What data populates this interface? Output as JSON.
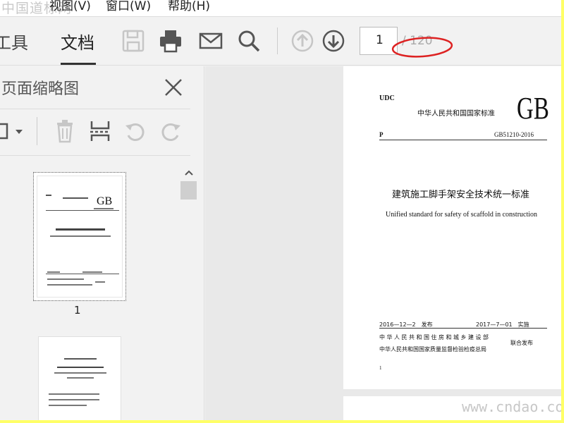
{
  "menu": {
    "items": [
      {
        "label": "视图(V)"
      },
      {
        "label": "窗口(W)"
      },
      {
        "label": "帮助(H)"
      }
    ],
    "watermark": "中国道标网"
  },
  "toolbar": {
    "tabs": [
      {
        "label": "工具"
      },
      {
        "label": "文档"
      }
    ],
    "page_number": "1",
    "page_total": "/ 120",
    "icons": [
      "save-icon",
      "print-icon",
      "mail-icon",
      "search-icon",
      "page-up-icon",
      "page-down-icon"
    ]
  },
  "panel": {
    "title": "页面缩略图",
    "tools": [
      "menu-icon",
      "delete-icon",
      "extract-icon",
      "rotate-left-icon",
      "rotate-right-icon"
    ],
    "thumbnails": [
      {
        "number": "1"
      }
    ]
  },
  "document": {
    "udc": "UDC",
    "issuer_line": "中华人民共和国国家标准",
    "gb": "GB",
    "p": "P",
    "code": "GB51210-2016",
    "title_cn": "建筑施工脚手架安全技术统一标准",
    "title_en": "Unified standard for safety of scaffold in construction",
    "issue_date": "2016—12—2　发布",
    "impl_date": "2017—7—01　实施",
    "publisher1": "中华人民共和国住房和城乡建设部",
    "publisher2": "中华人民共和国国家质量监督检验检疫总局",
    "joint": "联合发布",
    "page_footer": "1"
  },
  "watermark_bottom": "www.cndao.com",
  "colors": {
    "border_yellow": "#ffff66",
    "annotation_red": "#dd2222",
    "toolbar_bg": "#f2f2f2"
  }
}
